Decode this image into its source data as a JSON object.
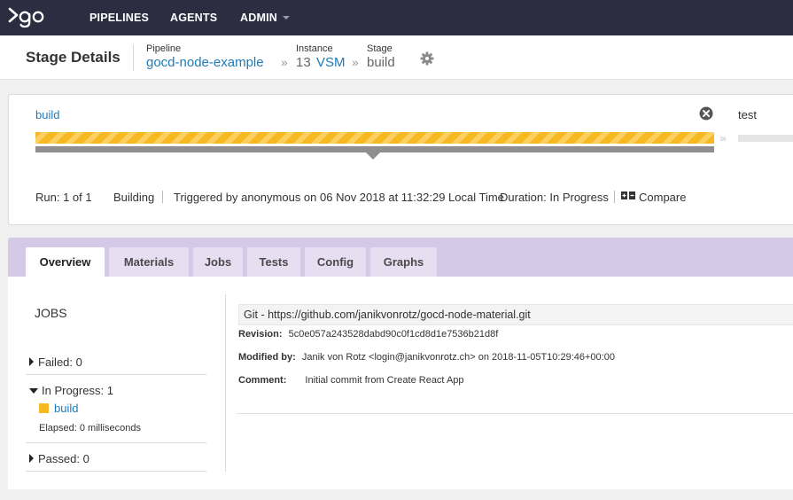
{
  "nav": {
    "items": [
      {
        "label": "PIPELINES"
      },
      {
        "label": "AGENTS"
      },
      {
        "label": "ADMIN"
      }
    ]
  },
  "header": {
    "title": "Stage Details",
    "pipeline_label": "Pipeline",
    "pipeline_value": "gocd-node-example",
    "instance_label": "Instance",
    "instance_number": "13",
    "instance_vsm": "VSM",
    "stage_label": "Stage",
    "stage_value": "build",
    "separator": "»"
  },
  "stage_bar": {
    "current_stage": "build",
    "next_stage": "test",
    "run": "Run: 1 of 1",
    "status": "Building",
    "triggered": "Triggered by anonymous on 06 Nov 2018 at 11:32:29 Local Time",
    "duration": "Duration: In Progress",
    "compare": "Compare",
    "arrows": "›››",
    "colors": {
      "progress": "#f6b921",
      "track": "#8f8f8f"
    }
  },
  "tabs": [
    {
      "label": "Overview",
      "active": true
    },
    {
      "label": "Materials",
      "active": false
    },
    {
      "label": "Jobs",
      "active": false
    },
    {
      "label": "Tests",
      "active": false
    },
    {
      "label": "Config",
      "active": false
    },
    {
      "label": "Graphs",
      "active": false
    }
  ],
  "jobs": {
    "title": "JOBS",
    "failed": "Failed: 0",
    "in_progress": "In Progress: 1",
    "in_progress_job": "build",
    "elapsed": "Elapsed: 0 milliseconds",
    "passed": "Passed: 0"
  },
  "material": {
    "header": "Git - https://github.com/janikvonrotz/gocd-node-material.git",
    "revision_label": "Revision:",
    "revision_value": "5c0e057a243528dabd90c0f1cd8d1e7536b21d8f",
    "modified_label": "Modified by:",
    "modified_value": "Janik von Rotz <login@janikvonrotz.ch> on 2018-11-05T10:29:46+00:00",
    "comment_label": "Comment:",
    "comment_value": "Initial commit from Create React App"
  },
  "icons": [
    "go-logo-icon",
    "gear-icon",
    "cancel-icon",
    "compare-icon",
    "caret-down-icon"
  ]
}
